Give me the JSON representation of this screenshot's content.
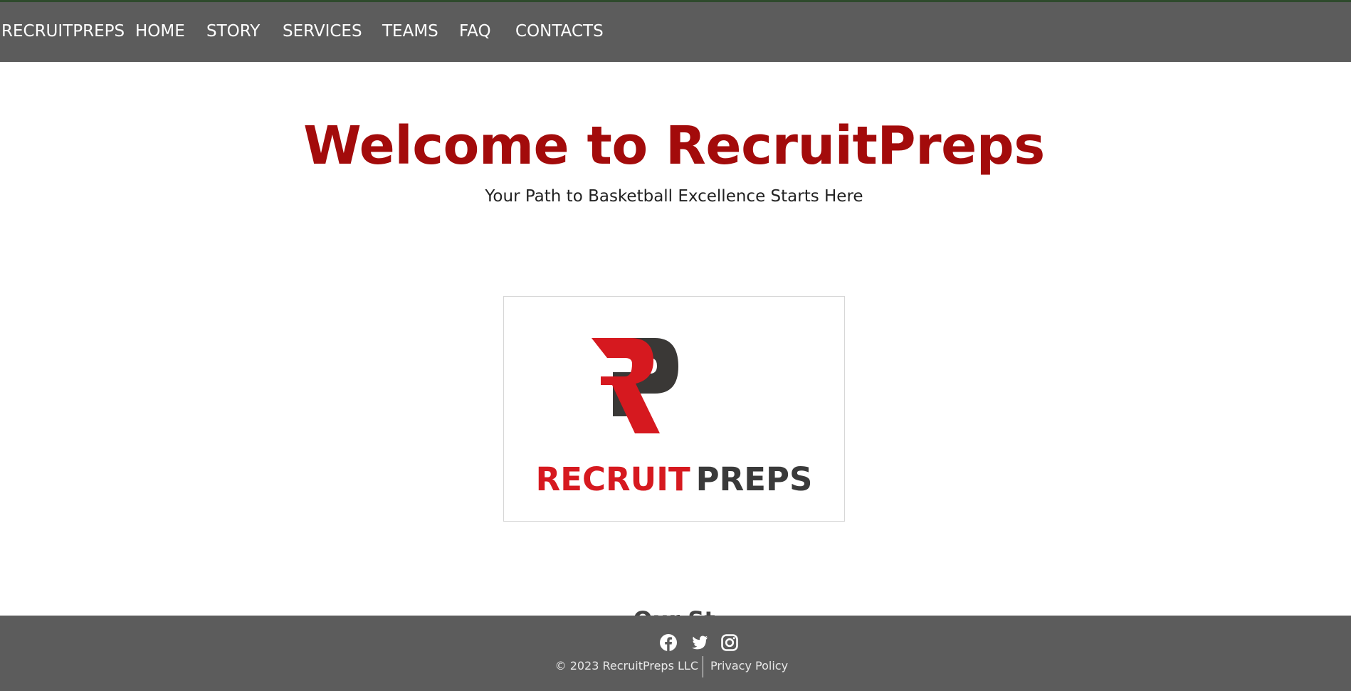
{
  "nav": {
    "brand": "RECRUITPREPS",
    "items": [
      "HOME",
      "STORY",
      "SERVICES",
      "TEAMS",
      "FAQ",
      "CONTACTS"
    ]
  },
  "hero": {
    "title": "Welcome to RecruitPreps",
    "subtitle": "Your Path to Basketball Excellence Starts Here"
  },
  "logo": {
    "word_red": "RECRUIT",
    "word_dark": "PREPS",
    "colors": {
      "red": "#d6191f",
      "dark": "#3a3a3a"
    }
  },
  "next_section": {
    "heading_partial": "Our St"
  },
  "footer": {
    "social_icons": [
      "facebook-icon",
      "twitter-icon",
      "instagram-icon"
    ],
    "copyright": "© 2023 RecruitPreps LLC",
    "privacy_link": "Privacy Policy"
  },
  "colors": {
    "nav_bg": "#5c5c5c",
    "title_red": "#a30b0b",
    "footer_bg": "#5c5c5c"
  }
}
